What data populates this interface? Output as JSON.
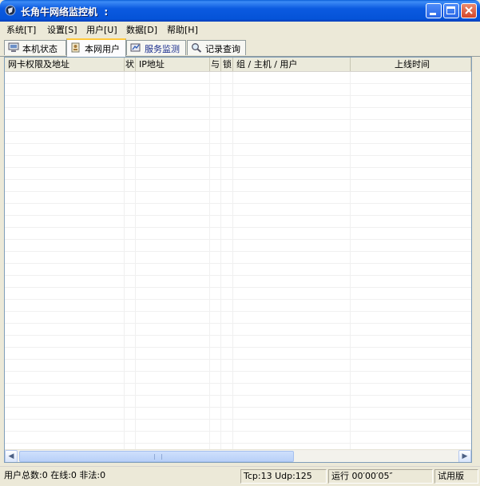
{
  "window": {
    "title": "长角牛网络监控机",
    "title_extra": "  :"
  },
  "menu": [
    "系统[T]",
    "设置[S]",
    "用户[U]",
    "数据[D]",
    "帮助[H]"
  ],
  "tabs": [
    {
      "label": "本机状态",
      "icon": "computer-icon"
    },
    {
      "label": "本网用户",
      "icon": "users-icon"
    },
    {
      "label": "服务监测",
      "icon": "service-icon"
    },
    {
      "label": "记录查询",
      "icon": "search-icon"
    }
  ],
  "columns": [
    "网卡权限及地址",
    "状",
    "IP地址",
    "与",
    "锁",
    "组 / 主机 / 用户",
    "上线时间"
  ],
  "status": {
    "users": "用户总数:0 在线:0 非法:0",
    "traffic": "Tcp:13 Udp:125",
    "runtime": "运行 00′00′05″",
    "edition": "试用版"
  },
  "colors": {
    "titlebar": "#0553d8",
    "tab_highlight": "#ffc83c",
    "chrome": "#ece9d8"
  }
}
